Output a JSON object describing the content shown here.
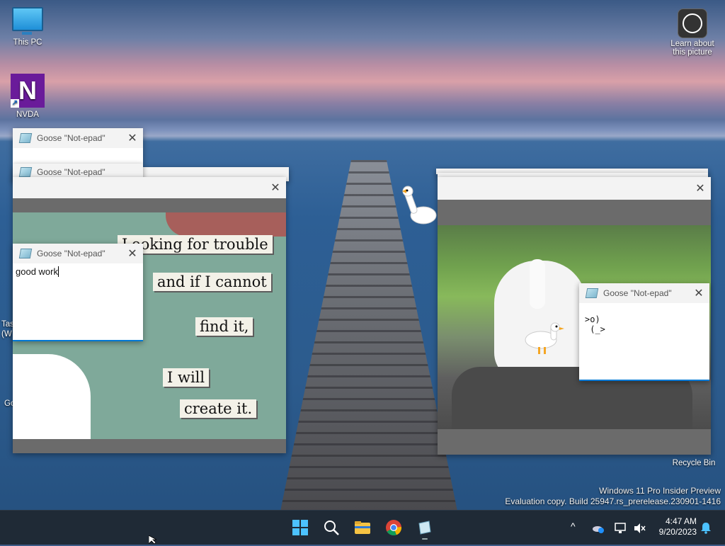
{
  "desktop": {
    "icons": [
      {
        "label": "This PC",
        "icon": "monitor-icon"
      },
      {
        "label": "NVDA",
        "icon": "nvda-icon"
      },
      {
        "label": "Recycle Bin",
        "icon": "recycle-bin-icon"
      }
    ],
    "learn_about": {
      "line1": "Learn about",
      "line2": "this picture"
    },
    "watermark": {
      "line1": "Windows 11 Pro Insider Preview",
      "line2": "Evaluation copy. Build 25947.rs_prerelease.230901-1416"
    },
    "clipped_labels": [
      "Tas",
      "(W",
      "Go"
    ]
  },
  "windows": {
    "title": "Goose \"Not-epad\"",
    "close_glyph": "✕",
    "notepad_small": {
      "text": "good work"
    },
    "notepad_right": {
      "line1": ">o)",
      "line2": " (_>"
    },
    "poster": {
      "lines": [
        "Looking for trouble",
        "and if I cannot",
        "find it,",
        "I will",
        "create it."
      ]
    }
  },
  "taskbar": {
    "apps": [
      {
        "name": "Start",
        "icon": "windows-start-icon"
      },
      {
        "name": "Search",
        "icon": "search-icon"
      },
      {
        "name": "File Explorer",
        "icon": "folder-icon"
      },
      {
        "name": "Google Chrome",
        "icon": "chrome-icon"
      },
      {
        "name": "Not-epad",
        "icon": "notepad-icon"
      }
    ],
    "tray": {
      "chevron": "^",
      "time": "4:47 AM",
      "date": "9/20/2023"
    }
  },
  "colors": {
    "taskbar": "#1f2a36",
    "accent": "#0078d4",
    "window_grey": "#6b6b6b"
  }
}
